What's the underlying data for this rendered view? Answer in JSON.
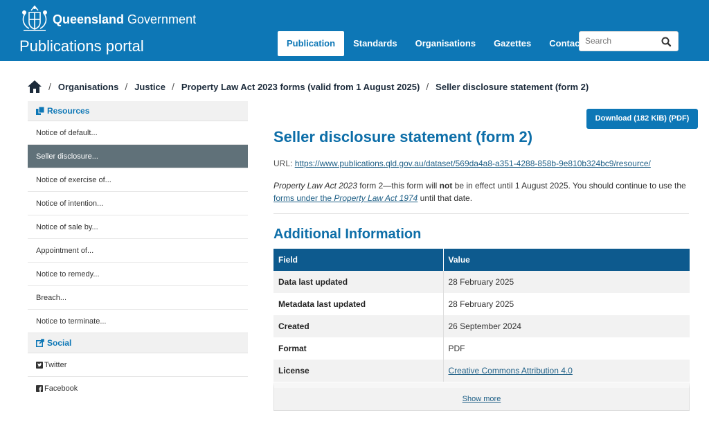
{
  "header": {
    "gov_bold": "Queensland",
    "gov_rest": " Government",
    "portal_title": "Publications portal",
    "nav": [
      "Publication",
      "Standards",
      "Organisations",
      "Gazettes",
      "Contact"
    ],
    "active_nav": "Publication",
    "search_placeholder": "Search"
  },
  "breadcrumb": [
    "Organisations",
    "Justice",
    "Property Law Act 2023 forms (valid from 1 August 2025)",
    "Seller disclosure statement (form 2)"
  ],
  "sidebar": {
    "resources_label": "Resources",
    "resources": [
      "Notice of default...",
      "Seller disclosure...",
      "Notice of exercise of...",
      "Notice of intention...",
      "Notice of sale by...",
      "Appointment of...",
      "Notice to remedy...",
      "Breach...",
      "Notice to terminate..."
    ],
    "active_resource": "Seller disclosure...",
    "social_label": "Social",
    "social": [
      "Twitter",
      "Facebook"
    ]
  },
  "main": {
    "download_label": "Download (182 KiB) (PDF)",
    "title": "Seller disclosure statement (form 2)",
    "url_label": "URL:",
    "url": "https://www.publications.qld.gov.au/dataset/569da4a8-a351-4288-858b-9e810b324bc9/resource/",
    "desc_act": "Property Law Act 2023",
    "desc_1": " form 2—this form will ",
    "desc_not": "not",
    "desc_2": " be in effect until 1 August 2025. You should continue to use the ",
    "desc_link_1": "forms under the ",
    "desc_link_act": "Property Law Act 1974",
    "desc_3": " until that date.",
    "additional_title": "Additional Information",
    "table_headers": [
      "Field",
      "Value"
    ],
    "table_rows": [
      [
        "Data last updated",
        "28 February 2025"
      ],
      [
        "Metadata last updated",
        "28 February 2025"
      ],
      [
        "Created",
        "26 September 2024"
      ],
      [
        "Format",
        "PDF"
      ],
      [
        "License",
        "Creative Commons Attribution 4.0"
      ]
    ],
    "show_more": "Show more"
  },
  "colors": {
    "brand_blue": "#0d77b6",
    "table_header": "#0d5a8e",
    "active_sidebar": "#607179",
    "link": "#1e5f86"
  }
}
